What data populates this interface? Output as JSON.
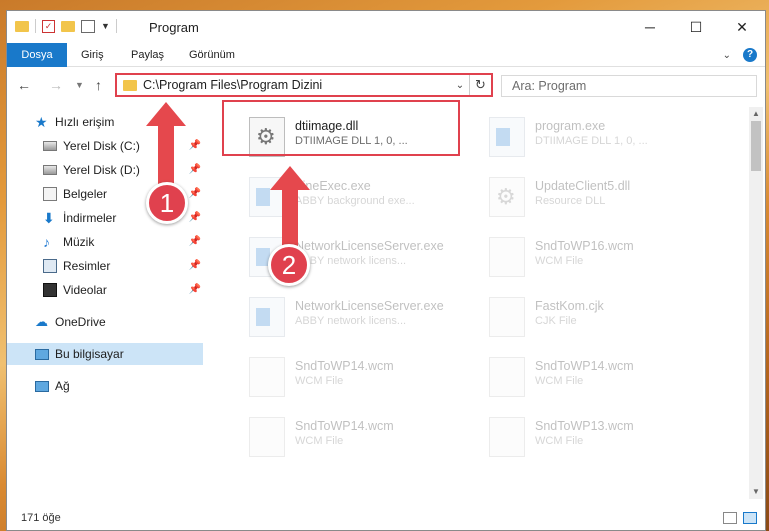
{
  "window": {
    "title": "Program"
  },
  "ribbon": {
    "tabs": [
      "Dosya",
      "Giriş",
      "Paylaş",
      "Görünüm"
    ]
  },
  "address": {
    "path": "C:\\Program Files\\Program Dizini"
  },
  "search": {
    "placeholder": "Ara: Program"
  },
  "sidebar": {
    "items": [
      {
        "label": "Hızlı erişim",
        "icon": "star-icon",
        "pinned": false
      },
      {
        "label": "Yerel Disk (C:)",
        "icon": "disk-icon",
        "pinned": true
      },
      {
        "label": "Yerel Disk (D:)",
        "icon": "disk-icon",
        "pinned": true
      },
      {
        "label": "Belgeler",
        "icon": "documents-icon",
        "pinned": true
      },
      {
        "label": "İndirmeler",
        "icon": "download-icon",
        "pinned": true
      },
      {
        "label": "Müzik",
        "icon": "music-icon",
        "pinned": true
      },
      {
        "label": "Resimler",
        "icon": "pictures-icon",
        "pinned": true
      },
      {
        "label": "Videolar",
        "icon": "videos-icon",
        "pinned": true
      },
      {
        "label": "OneDrive",
        "icon": "cloud-icon",
        "pinned": false
      },
      {
        "label": "Bu bilgisayar",
        "icon": "computer-icon",
        "pinned": false,
        "selected": true
      },
      {
        "label": "Ağ",
        "icon": "network-icon",
        "pinned": false
      }
    ]
  },
  "files": [
    {
      "name": "dtiimage.dll",
      "desc": "DTIIMAGE DLL 1, 0, ...",
      "icon": "dll-gear-icon",
      "highlighted": true
    },
    {
      "name": "program.exe",
      "desc": "DTIIMAGE DLL 1, 0, ...",
      "icon": "exe-icon"
    },
    {
      "name": "FineExec.exe",
      "desc": "ABBY background exe...",
      "icon": "exe-icon"
    },
    {
      "name": "UpdateClient5.dll",
      "desc": "Resource DLL",
      "icon": "dll-gear-icon"
    },
    {
      "name": "NetworkLicenseServer.exe",
      "desc": "ABBY network licens...",
      "icon": "exe-icon"
    },
    {
      "name": "SndToWP16.wcm",
      "desc": "WCM File",
      "icon": "file-icon"
    },
    {
      "name": "NetworkLicenseServer.exe",
      "desc": "ABBY network licens...",
      "icon": "exe-icon"
    },
    {
      "name": "FastKom.cjk",
      "desc": "CJK File",
      "icon": "file-icon"
    },
    {
      "name": "SndToWP14.wcm",
      "desc": "WCM File",
      "icon": "file-icon"
    },
    {
      "name": "SndToWP14.wcm",
      "desc": "WCM File",
      "icon": "file-icon"
    },
    {
      "name": "SndToWP14.wcm",
      "desc": "WCM File",
      "icon": "file-icon"
    },
    {
      "name": "SndToWP13.wcm",
      "desc": "WCM File",
      "icon": "file-icon"
    }
  ],
  "status": {
    "item_count": "171 öğe"
  },
  "annotations": {
    "step1": "1",
    "step2": "2"
  },
  "colors": {
    "accent": "#1979ca",
    "highlight_red": "#e0414e",
    "selected_bg": "#cce4f7"
  }
}
